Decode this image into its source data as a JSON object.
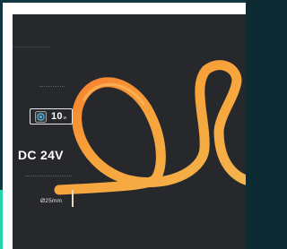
{
  "product": {
    "badge": {
      "icon": "circle-dot-icon",
      "value": "10",
      "unit": "w"
    },
    "voltage_label": "DC 24V",
    "diameter_label": "Ø25mm"
  },
  "colors": {
    "panel_background": "#26282b",
    "frame_background": "#123640",
    "accent_green": "#1fd6a4",
    "tube_orange": "#f7a33a",
    "tube_deep_orange": "#f5782c",
    "text_white": "#ffffff"
  }
}
